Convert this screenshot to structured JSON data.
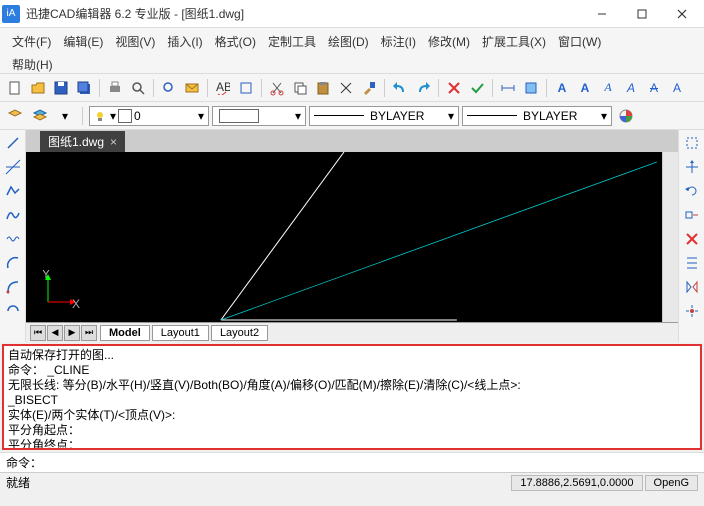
{
  "title": "迅捷CAD编辑器 6.2 专业版  - [图纸1.dwg]",
  "menu": {
    "file": "文件(F)",
    "edit": "编辑(E)",
    "view": "视图(V)",
    "insert": "插入(I)",
    "format": "格式(O)",
    "custom": "定制工具",
    "draw": "绘图(D)",
    "annotate": "标注(I)",
    "modify": "修改(M)",
    "ext": "扩展工具(X)",
    "window": "窗口(W)",
    "help": "帮助(H)"
  },
  "doc_tab": {
    "name": "图纸1.dwg",
    "close": "×"
  },
  "layer_combo": "0",
  "prop_combo_1": "BYLAYER",
  "prop_combo_2": "BYLAYER",
  "layout": {
    "model": "Model",
    "l1": "Layout1",
    "l2": "Layout2"
  },
  "cmd": {
    "l1": "自动保存打开的图...",
    "l2": "命令：  _CLINE",
    "l3": "无限长线:  等分(B)/水平(H)/竖直(V)/Both(BO)/角度(A)/偏移(O)/匹配(M)/擦除(E)/清除(C)/<线上点>:",
    "l4": " _BISECT",
    "l5": "实体(E)/两个实体(T)/<顶点(V)>:",
    "l6": "平分角起点：",
    "l7": "平分角终点："
  },
  "cmd_prompt": "命令：",
  "status_left": "就绪",
  "status_coords": "17.8886,2.5691,0.0000",
  "status_render": "OpenG",
  "text_labels": {
    "A1": "A",
    "A2": "A",
    "A3": "A",
    "A4": "A",
    "A5": "A",
    "A6": "A"
  }
}
